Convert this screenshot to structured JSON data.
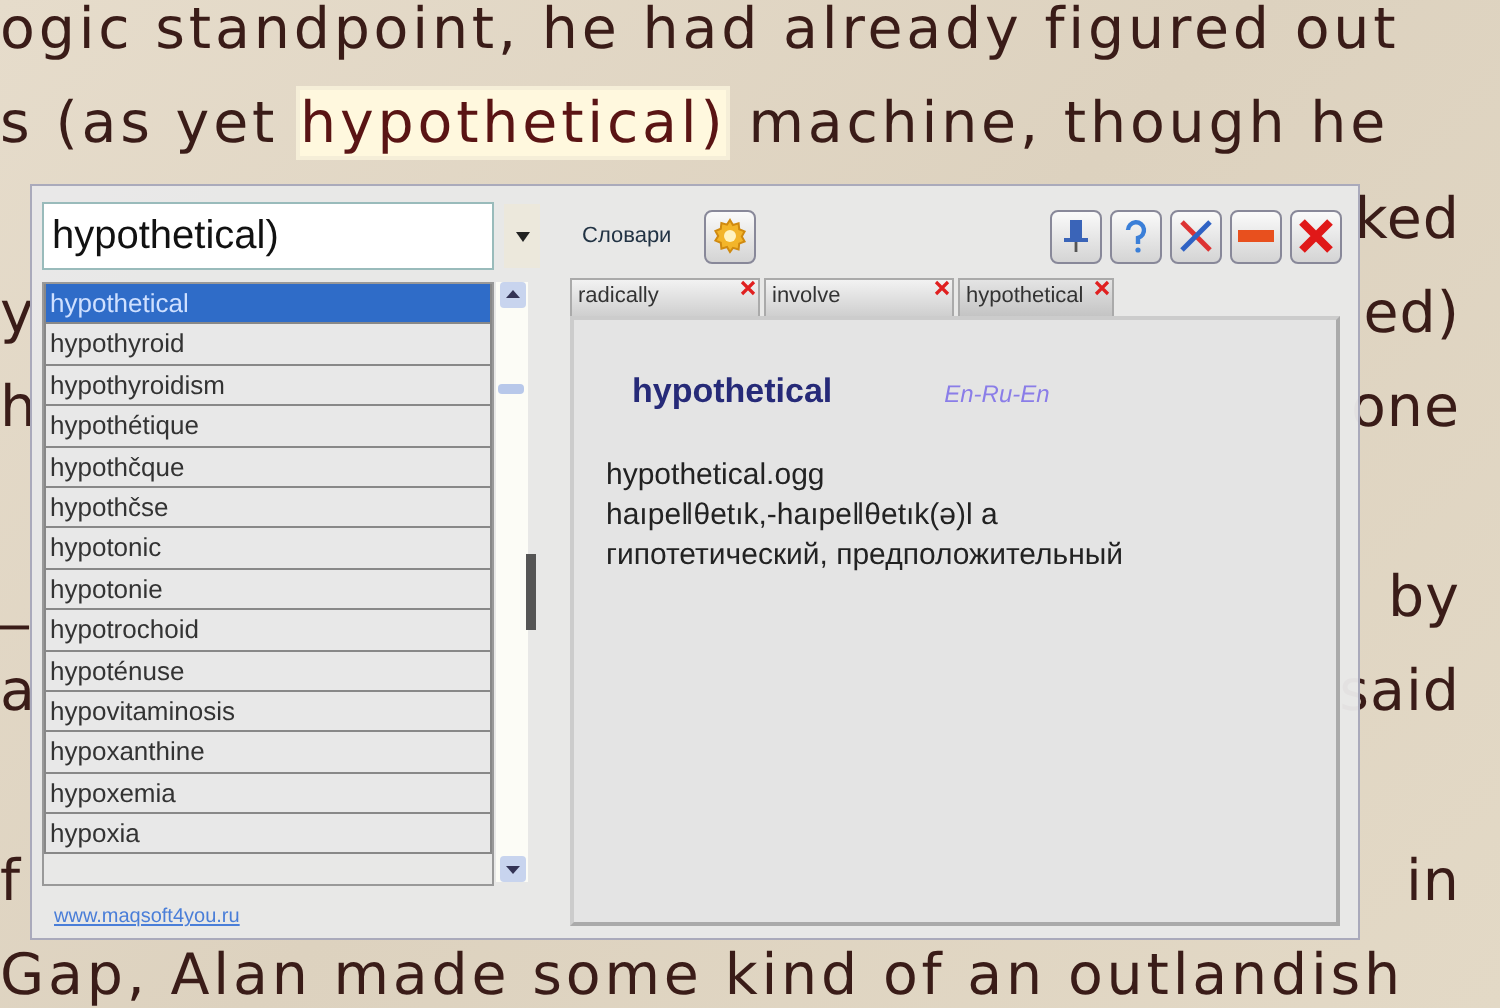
{
  "book": {
    "lines": [
      {
        "kind": "text",
        "left": "ogic standpoint, he had already figured out"
      },
      {
        "kind": "text",
        "left": "s (as yet ",
        "highlight": "hypothetical)",
        "after": " machine, though he"
      },
      {
        "kind": "text",
        "right": "ked"
      },
      {
        "kind": "text",
        "left": "y",
        "right": "ed)"
      },
      {
        "kind": "text",
        "left": "h",
        "right": "one"
      },
      {
        "kind": "blank"
      },
      {
        "kind": "text",
        "left": "_",
        "right": "by"
      },
      {
        "kind": "text",
        "left": "a",
        "right": "said"
      },
      {
        "kind": "blank"
      },
      {
        "kind": "text",
        "left": "f",
        "right": "in"
      },
      {
        "kind": "text",
        "left": "Gap, Alan made some kind of an outlandish"
      }
    ]
  },
  "popup": {
    "search": {
      "value": "hypothetical)"
    },
    "dictionaries_label": "Словари",
    "suggestions": [
      {
        "word": "hypothetical",
        "selected": true
      },
      {
        "word": "hypothyroid",
        "selected": false
      },
      {
        "word": "hypothyroidism",
        "selected": false
      },
      {
        "word": "hypothétique",
        "selected": false
      },
      {
        "word": "hypothčque",
        "selected": false
      },
      {
        "word": "hypothčse",
        "selected": false
      },
      {
        "word": "hypotonic",
        "selected": false
      },
      {
        "word": "hypotonie",
        "selected": false
      },
      {
        "word": "hypotrochoid",
        "selected": false
      },
      {
        "word": "hypoténuse",
        "selected": false
      },
      {
        "word": "hypovitaminosis",
        "selected": false
      },
      {
        "word": "hypoxanthine",
        "selected": false
      },
      {
        "word": "hypoxemia",
        "selected": false
      },
      {
        "word": "hypoxia",
        "selected": false
      }
    ],
    "link": "www.maqsoft4you.ru",
    "tabs": [
      {
        "label": "radically",
        "selected": false
      },
      {
        "label": "involve",
        "selected": false
      },
      {
        "label": "hypothetical",
        "selected": true
      }
    ],
    "entry": {
      "headword": "hypothetical",
      "direction": "En-Ru-En",
      "lines": [
        "hypothetical.ogg",
        "haıpeǁθetık,-haıpeǁθetık(ə)l a",
        "гипотетический, предположительный"
      ]
    }
  }
}
